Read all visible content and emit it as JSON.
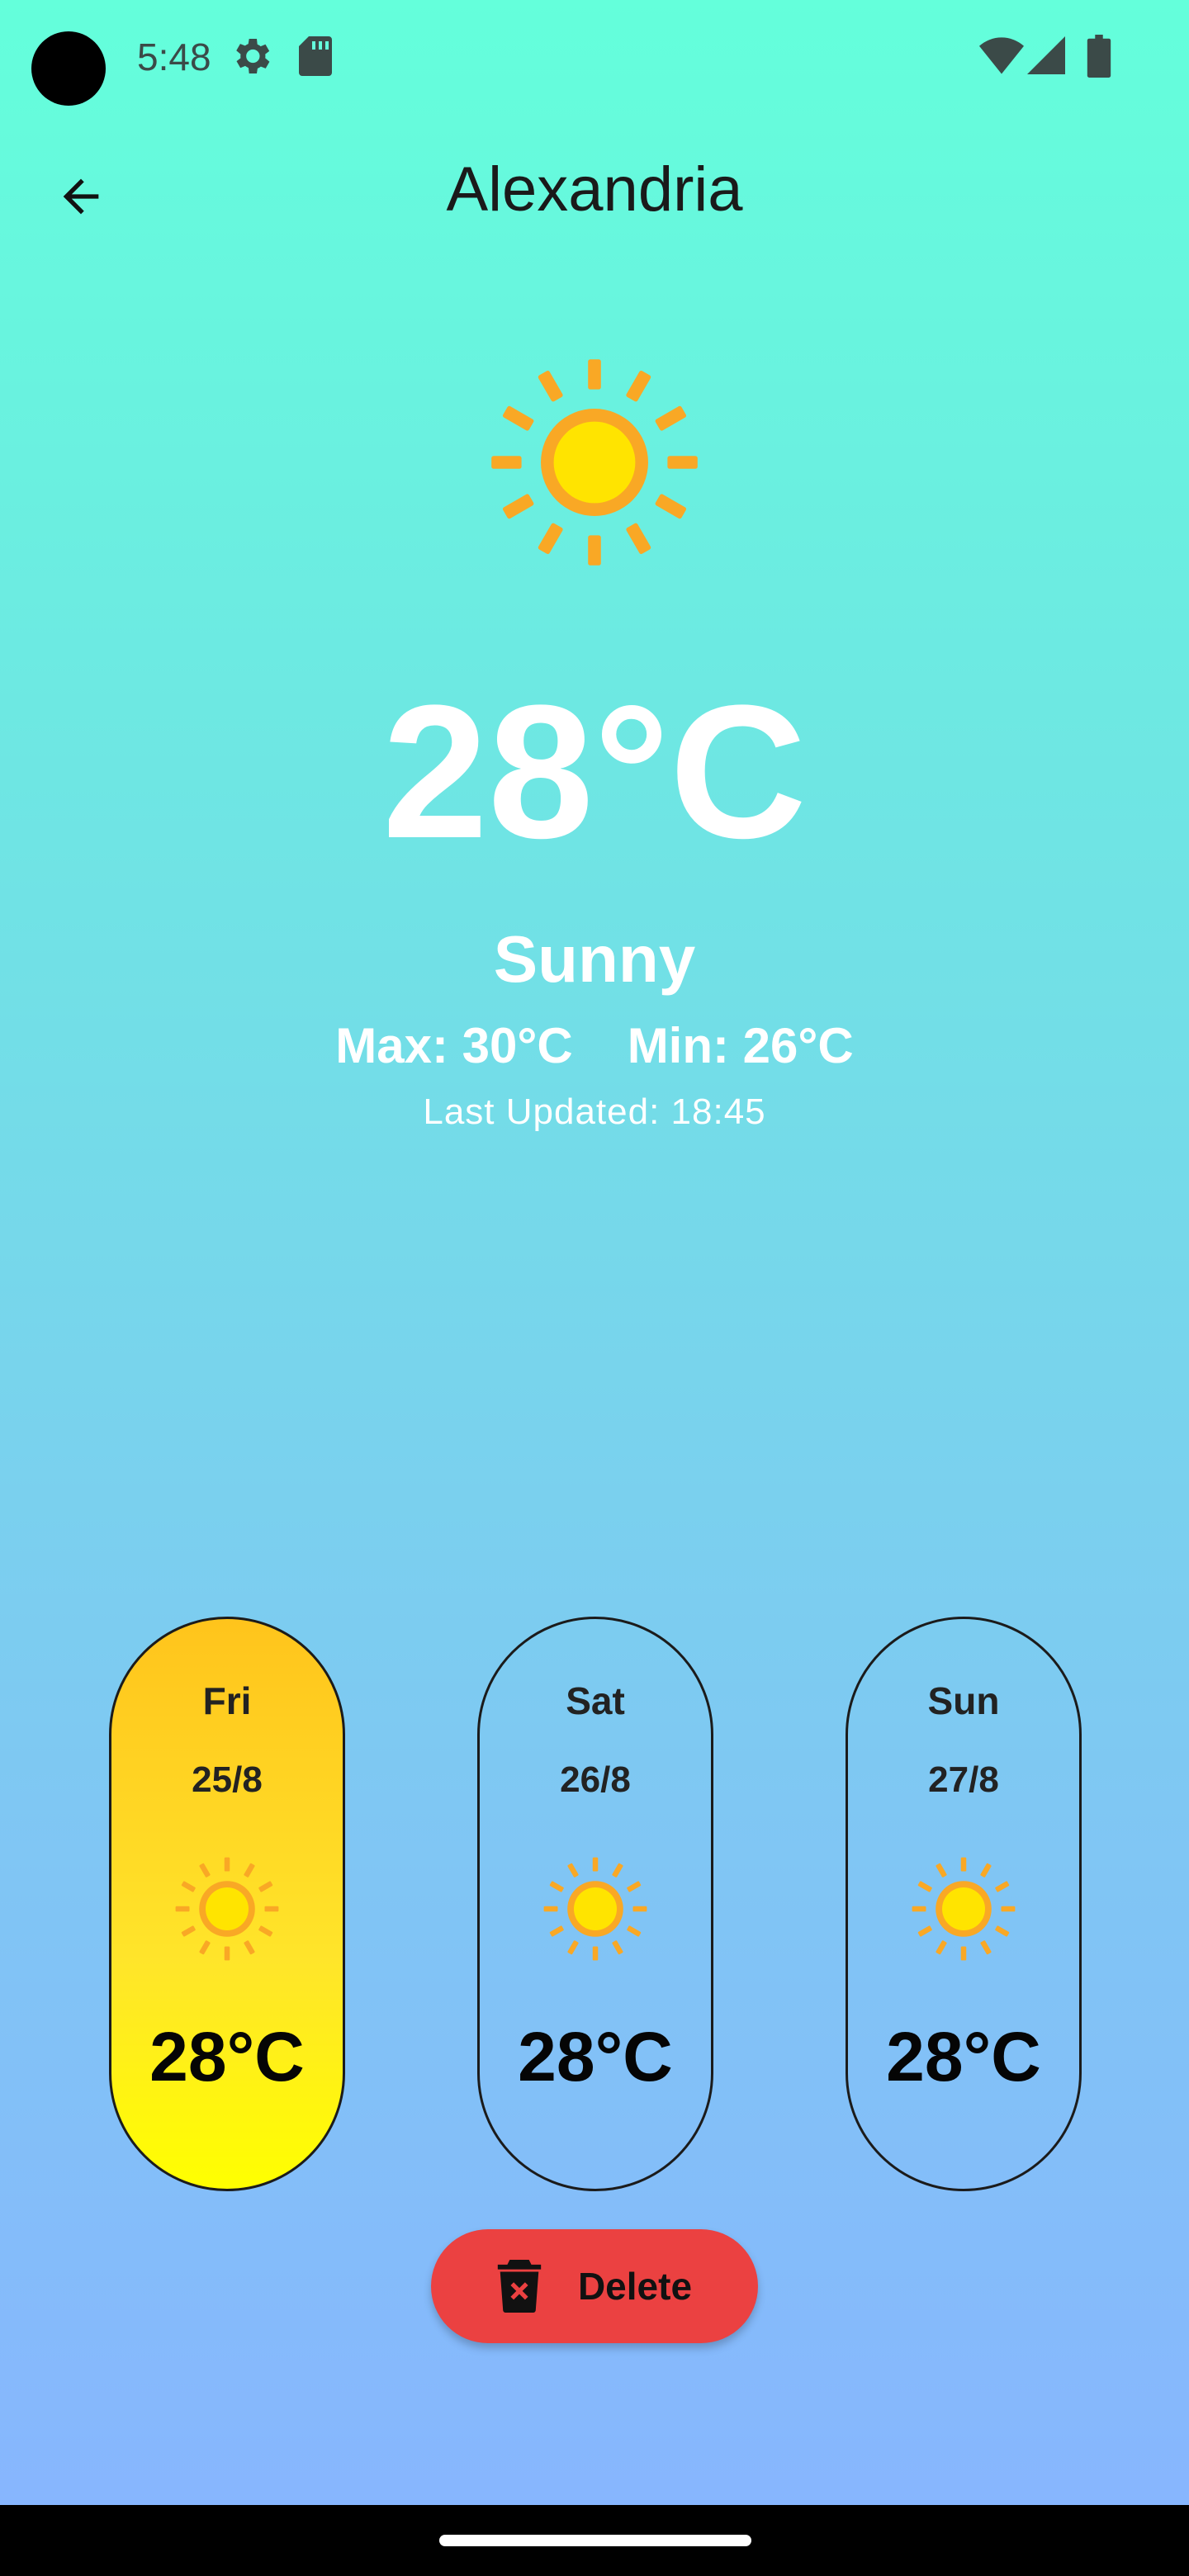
{
  "status_bar": {
    "time": "5:48",
    "icons": [
      "settings-icon",
      "sd-card-icon",
      "wifi-icon",
      "cell-signal-icon",
      "battery-icon"
    ]
  },
  "app_bar": {
    "back_icon": "arrow-left-icon",
    "title": "Alexandria"
  },
  "current": {
    "icon": "sun-icon",
    "temperature": "28°C",
    "condition": "Sunny",
    "max": "Max: 30°C",
    "min": "Min: 26°C",
    "last_updated": "Last Updated: 18:45"
  },
  "forecast": [
    {
      "day": "Fri",
      "date": "25/8",
      "icon": "sun-icon",
      "temperature": "28°C",
      "selected": true
    },
    {
      "day": "Sat",
      "date": "26/8",
      "icon": "sun-icon",
      "temperature": "28°C",
      "selected": false
    },
    {
      "day": "Sun",
      "date": "27/8",
      "icon": "sun-icon",
      "temperature": "28°C",
      "selected": false
    }
  ],
  "delete_button": {
    "label": "Delete",
    "icon": "trash-icon"
  },
  "colors": {
    "background_top": "#64ffdb",
    "background_bottom": "#88b4ff",
    "selected_card": "#ffe52a",
    "delete_button": "#eb4141",
    "sun_ray": "#f9a825",
    "sun_core": "#ffe400"
  }
}
